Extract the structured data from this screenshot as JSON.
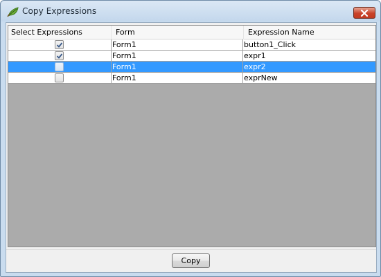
{
  "window": {
    "title": "Copy Expressions",
    "app_icon": "leaf-icon",
    "close_icon": "close-icon"
  },
  "grid": {
    "columns": [
      "Select Expressions",
      "Form",
      "Expression Name"
    ],
    "rows": [
      {
        "selected_checkbox": true,
        "form": "Form1",
        "expression": "button1_Click",
        "highlighted": false
      },
      {
        "selected_checkbox": true,
        "form": "Form1",
        "expression": "expr1",
        "highlighted": false
      },
      {
        "selected_checkbox": false,
        "form": "Form1",
        "expression": "expr2",
        "highlighted": true
      },
      {
        "selected_checkbox": false,
        "form": "Form1",
        "expression": "exprNew",
        "highlighted": false
      }
    ]
  },
  "footer": {
    "copy_label": "Copy"
  },
  "colors": {
    "selection": "#3399ff",
    "close_button": "#c8432a",
    "frame": "#c9dcef"
  }
}
